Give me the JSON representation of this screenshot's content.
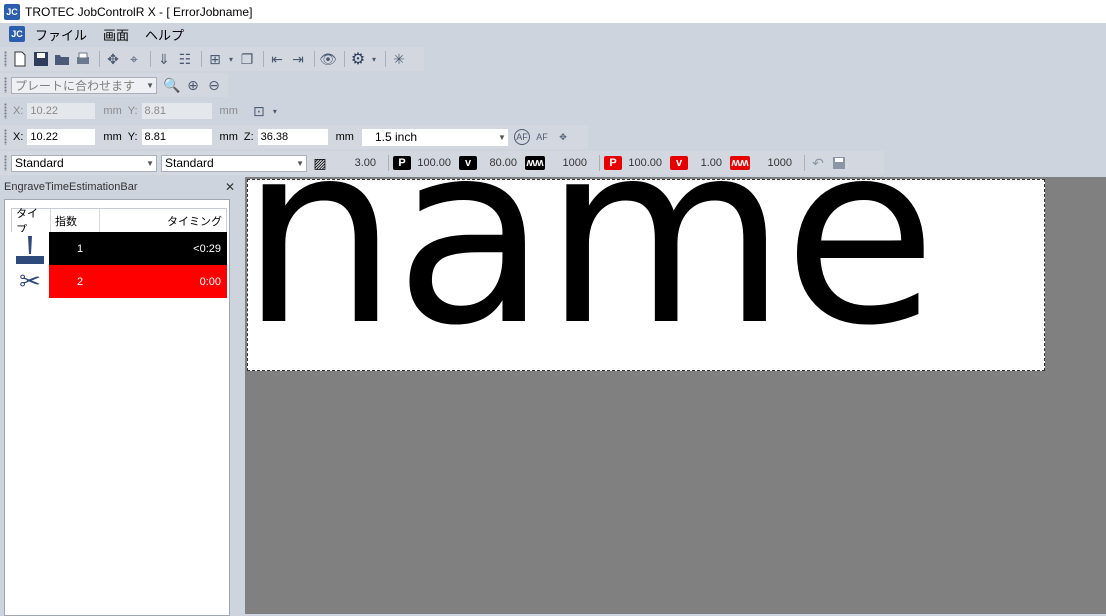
{
  "window": {
    "title": "TROTEC JobControlR X - [ ErrorJobname]",
    "icon_text": "JC"
  },
  "menu": {
    "items": [
      "ファイル",
      "画面",
      "ヘルプ"
    ]
  },
  "toolbar_zoom": {
    "plate_fit": "プレートに合わせます"
  },
  "position_disabled": {
    "x_label": "X:",
    "x_value": "10.22",
    "x_unit": "mm",
    "y_label": "Y:",
    "y_value": "8.81",
    "y_unit": "mm"
  },
  "position": {
    "x_label": "X:",
    "x_value": "10.22",
    "x_unit": "mm",
    "y_label": "Y:",
    "y_value": "8.81",
    "y_unit": "mm",
    "z_label": "Z:",
    "z_value": "36.38",
    "z_unit": "mm",
    "lens": "1.5 inch"
  },
  "params": {
    "material1": "Standard",
    "material2": "Standard",
    "thickness": "3.00",
    "engrave": {
      "p_label": "P",
      "power": "100.00",
      "v_label": "v",
      "speed": "80.00",
      "freq": "1000",
      "color": "#000000"
    },
    "cut": {
      "p_label": "P",
      "power": "100.00",
      "v_label": "v",
      "speed": "1.00",
      "freq": "1000",
      "color": "#e60000"
    }
  },
  "estimation_panel": {
    "title": "EngraveTimeEstimationBar",
    "close": "✕",
    "columns": [
      "タイプ",
      "指数",
      "タイミング"
    ],
    "rows": [
      {
        "index": "1",
        "time": "<0:29",
        "color": "#000000",
        "type_icon": "engrave-icon"
      },
      {
        "index": "2",
        "time": "0:00",
        "color": "#ff0000",
        "type_icon": "scissors-icon"
      }
    ]
  },
  "canvas": {
    "text": "name"
  }
}
